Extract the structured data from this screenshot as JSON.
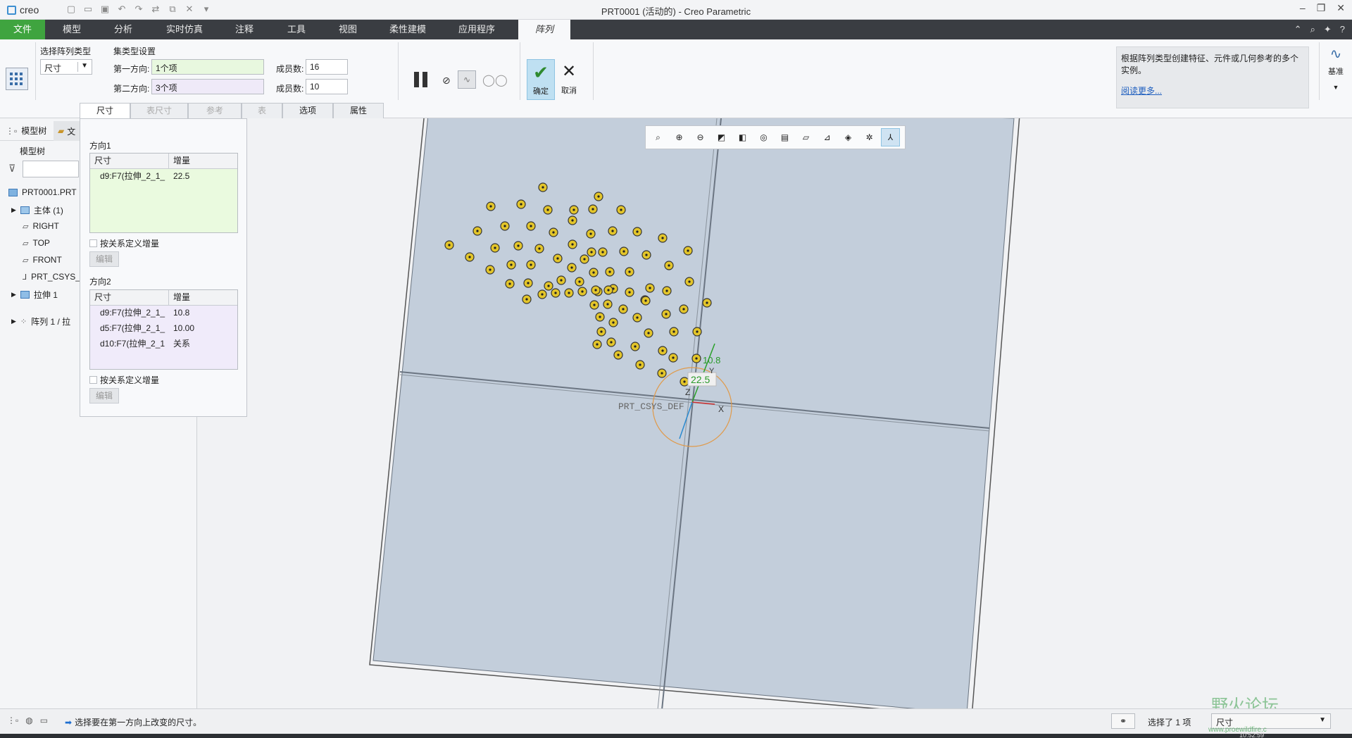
{
  "app": {
    "logo": "creo",
    "window_title": "PRT0001 (活动的) - Creo Parametric"
  },
  "menu": {
    "tabs": [
      "文件",
      "模型",
      "分析",
      "实时仿真",
      "注释",
      "工具",
      "视图",
      "柔性建模",
      "应用程序",
      "阵列"
    ],
    "active_tab": "阵列"
  },
  "ribbon": {
    "pattern_type_label": "选择阵列类型",
    "pattern_type_value": "尺寸",
    "set_type_label": "集类型设置",
    "dir1_label": "第一方向:",
    "dir1_value": "1个项",
    "dir2_label": "第二方向:",
    "dir2_value": "3个项",
    "members1_label": "成员数:",
    "members1_value": "16",
    "members2_label": "成员数:",
    "members2_value": "10",
    "ok_label": "确定",
    "cancel_label": "取消",
    "help_text": "根据阵列类型创建特征、元件或几何参考的多个实例。",
    "help_link": "阅读更多...",
    "datum_label": "基准",
    "subtabs": [
      "尺寸",
      "表尺寸",
      "参考",
      "表",
      "选项",
      "属性"
    ]
  },
  "left": {
    "tabs": [
      "模型树",
      "文"
    ],
    "tree_title": "模型树",
    "items": [
      {
        "label": "PRT0001.PRT"
      },
      {
        "label": "主体 (1)"
      },
      {
        "label": "RIGHT"
      },
      {
        "label": "TOP"
      },
      {
        "label": "FRONT"
      },
      {
        "label": "PRT_CSYS_"
      },
      {
        "label": "拉伸 1"
      },
      {
        "label": "阵列 1 / 拉"
      }
    ]
  },
  "popup": {
    "dir1_title": "方向1",
    "dir2_title": "方向2",
    "col_dim": "尺寸",
    "col_inc": "增量",
    "dir1_rows": [
      {
        "dim": "d9:F7(拉伸_2_1_",
        "inc": "22.5"
      }
    ],
    "dir2_rows": [
      {
        "dim": "d9:F7(拉伸_2_1_",
        "inc": "10.8"
      },
      {
        "dim": "d5:F7(拉伸_2_1_",
        "inc": "10.00"
      },
      {
        "dim": "d10:F7(拉伸_2_1",
        "inc": "关系"
      }
    ],
    "relation_checkbox": "按关系定义增量",
    "edit_button": "编辑"
  },
  "viewport": {
    "csys_label": "PRT_CSYS_DEF",
    "axis_x": "X",
    "axis_z": "Z",
    "axis_y": "Y",
    "dim_tag1": "22.5",
    "dim_tag2": "10.8"
  },
  "status": {
    "message": "选择要在第一方向上改变的尺寸。",
    "selected": "选择了 1 项",
    "filter_value": "尺寸",
    "watermark": "野火论坛",
    "watermark_url": "www.proewildfire.c",
    "clock": "10:52:59"
  },
  "colors": {
    "file_tab": "#3fa43f",
    "menubar": "#3a3d42",
    "plate": "#c3cedb",
    "marker": "#e3c52a",
    "accent_blue": "#1f5fbf"
  }
}
